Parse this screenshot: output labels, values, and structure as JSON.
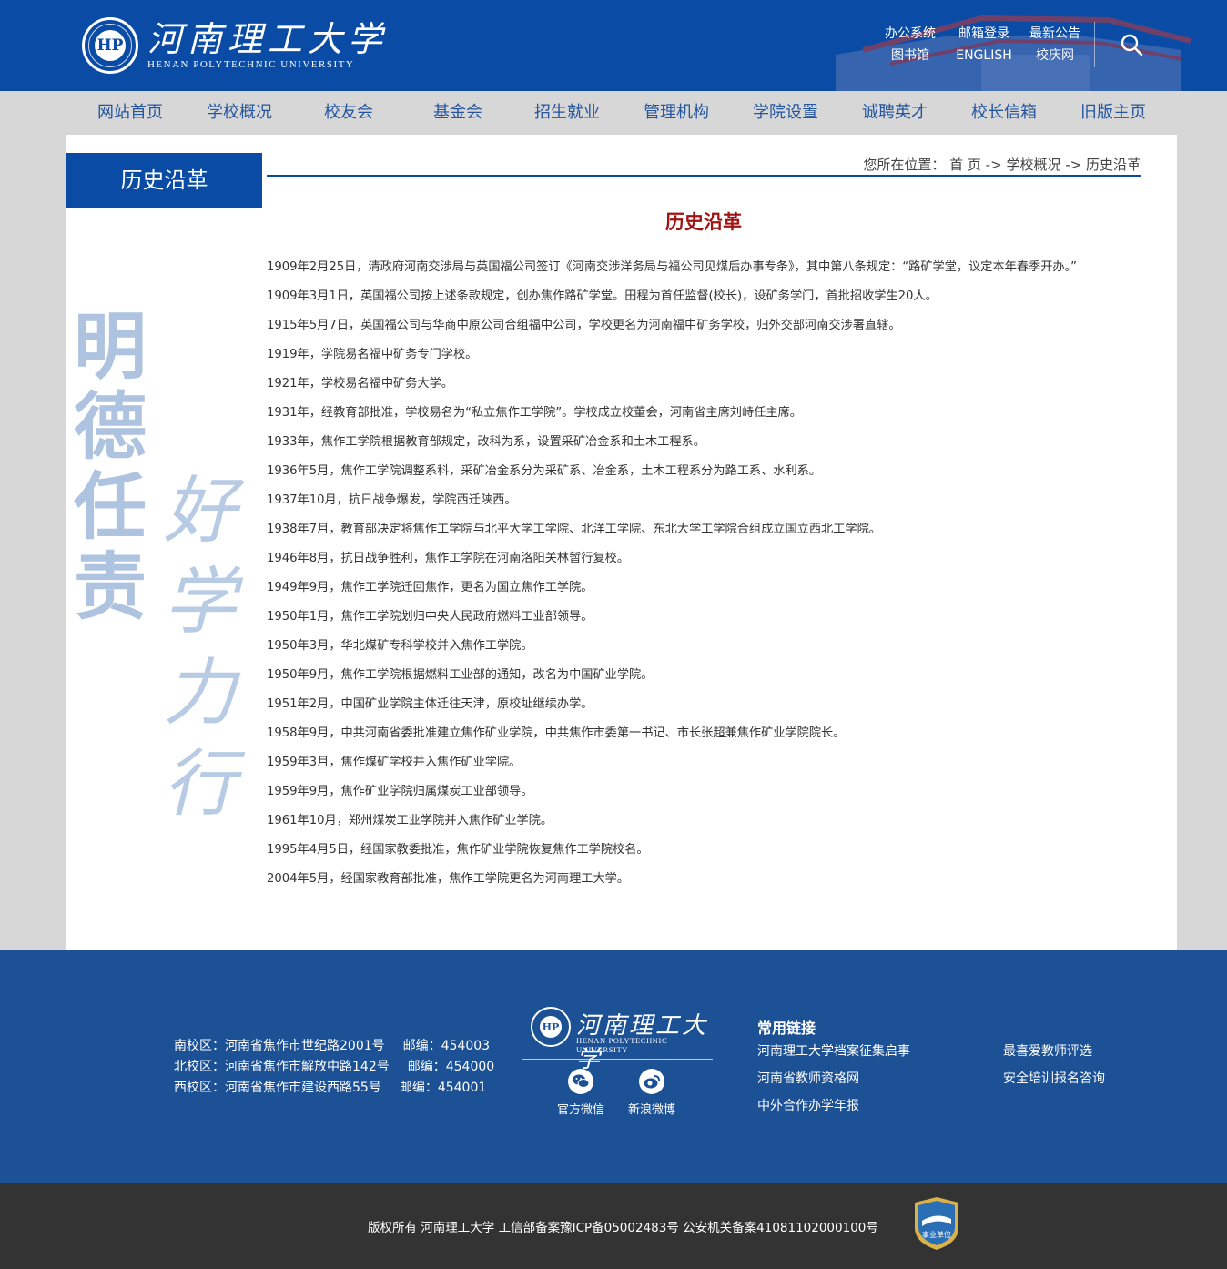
{
  "header": {
    "logo_cn": "河南理工大学",
    "logo_en": "HENAN POLYTECHNIC UNIVERSITY",
    "logo_seal": "HP",
    "top_links": [
      "办公系统",
      "邮箱登录",
      "最新公告",
      "图书馆",
      "ENGLISH",
      "校庆网"
    ],
    "search_icon": "search-icon"
  },
  "nav": {
    "items": [
      "网站首页",
      "学校概况",
      "校友会",
      "基金会",
      "招生就业",
      "管理机构",
      "学院设置",
      "诚聘英才",
      "校长信箱",
      "旧版主页"
    ]
  },
  "sidebar": {
    "title": "历史沿革",
    "calligraphy_col1": "明德任责",
    "calligraphy_col2": "好学力行"
  },
  "breadcrumb": {
    "prefix": "您所在位置：",
    "home": "首 页",
    "sep1": " -> ",
    "level1": "学校概况",
    "sep2": " -> ",
    "level2": "历史沿革"
  },
  "article": {
    "title": "历史沿革",
    "paragraphs": [
      "1909年2月25日，清政府河南交涉局与英国福公司签订《河南交涉洋务局与福公司见煤后办事专条》，其中第八条规定：“路矿学堂，议定本年春季开办。”",
      "1909年3月1日，英国福公司按上述条款规定，创办焦作路矿学堂。田程为首任监督(校长)，设矿务学门，首批招收学生20人。",
      "1915年5月7日，英国福公司与华商中原公司合组福中公司，学校更名为河南福中矿务学校，归外交部河南交涉署直辖。",
      "1919年，学院易名福中矿务专门学校。",
      "1921年，学校易名福中矿务大学。",
      "1931年，经教育部批准，学校易名为“私立焦作工学院”。学校成立校董会，河南省主席刘峙任主席。",
      "1933年，焦作工学院根据教育部规定，改科为系，设置采矿冶金系和土木工程系。",
      "1936年5月，焦作工学院调整系科，采矿冶金系分为采矿系、冶金系，土木工程系分为路工系、水利系。",
      "1937年10月，抗日战争爆发，学院西迁陕西。",
      "1938年7月，教育部决定将焦作工学院与北平大学工学院、北洋工学院、东北大学工学院合组成立国立西北工学院。",
      "1946年8月，抗日战争胜利，焦作工学院在河南洛阳关林暂行复校。",
      "1949年9月，焦作工学院迁回焦作，更名为国立焦作工学院。",
      "1950年1月，焦作工学院划归中央人民政府燃料工业部领导。",
      "1950年3月，华北煤矿专科学校并入焦作工学院。",
      "1950年9月，焦作工学院根据燃料工业部的通知，改名为中国矿业学院。",
      "1951年2月，中国矿业学院主体迁往天津，原校址继续办学。",
      "1958年9月，中共河南省委批准建立焦作矿业学院，中共焦作市委第一书记、市长张超兼焦作矿业学院院长。",
      "1959年3月，焦作煤矿学校并入焦作矿业学院。",
      "1959年9月，焦作矿业学院归属煤炭工业部领导。",
      "1961年10月，郑州煤炭工业学院并入焦作矿业学院。",
      "1995年4月5日，经国家教委批准，焦作矿业学院恢复焦作工学院校名。",
      "2004年5月，经国家教育部批准，焦作工学院更名为河南理工大学。"
    ]
  },
  "footer": {
    "addresses": [
      {
        "campus": "南校区：河南省焦作市世纪路2001号",
        "zip": "邮编：454003"
      },
      {
        "campus": "北校区：河南省焦作市解放中路142号",
        "zip": "邮编：454000"
      },
      {
        "campus": "西校区：河南省焦作市建设西路55号",
        "zip": "邮编：454001"
      }
    ],
    "logo_cn": "河南理工大学",
    "logo_en": "HENAN POLYTECHNIC UNIVERSITY",
    "logo_seal": "HP",
    "social": [
      {
        "label": "官方微信",
        "icon": "wechat-icon"
      },
      {
        "label": "新浪微博",
        "icon": "weibo-icon"
      }
    ],
    "links_title": "常用链接",
    "links": [
      "河南理工大学档案征集启事",
      "最喜爱教师评选",
      "河南省教师资格网",
      "安全培训报名咨询",
      "中外合作办学年报"
    ],
    "copyright": "版权所有 河南理工大学 工信部备案豫ICP备05002483号 公安机关备案41081102000100号",
    "badge_text": "事业单位"
  },
  "colors": {
    "primary_blue": "#0a4ba5",
    "footer_blue": "#1c5196",
    "nav_text": "#2456a0",
    "title_red": "#a01313",
    "bottom_bar": "#333333"
  }
}
